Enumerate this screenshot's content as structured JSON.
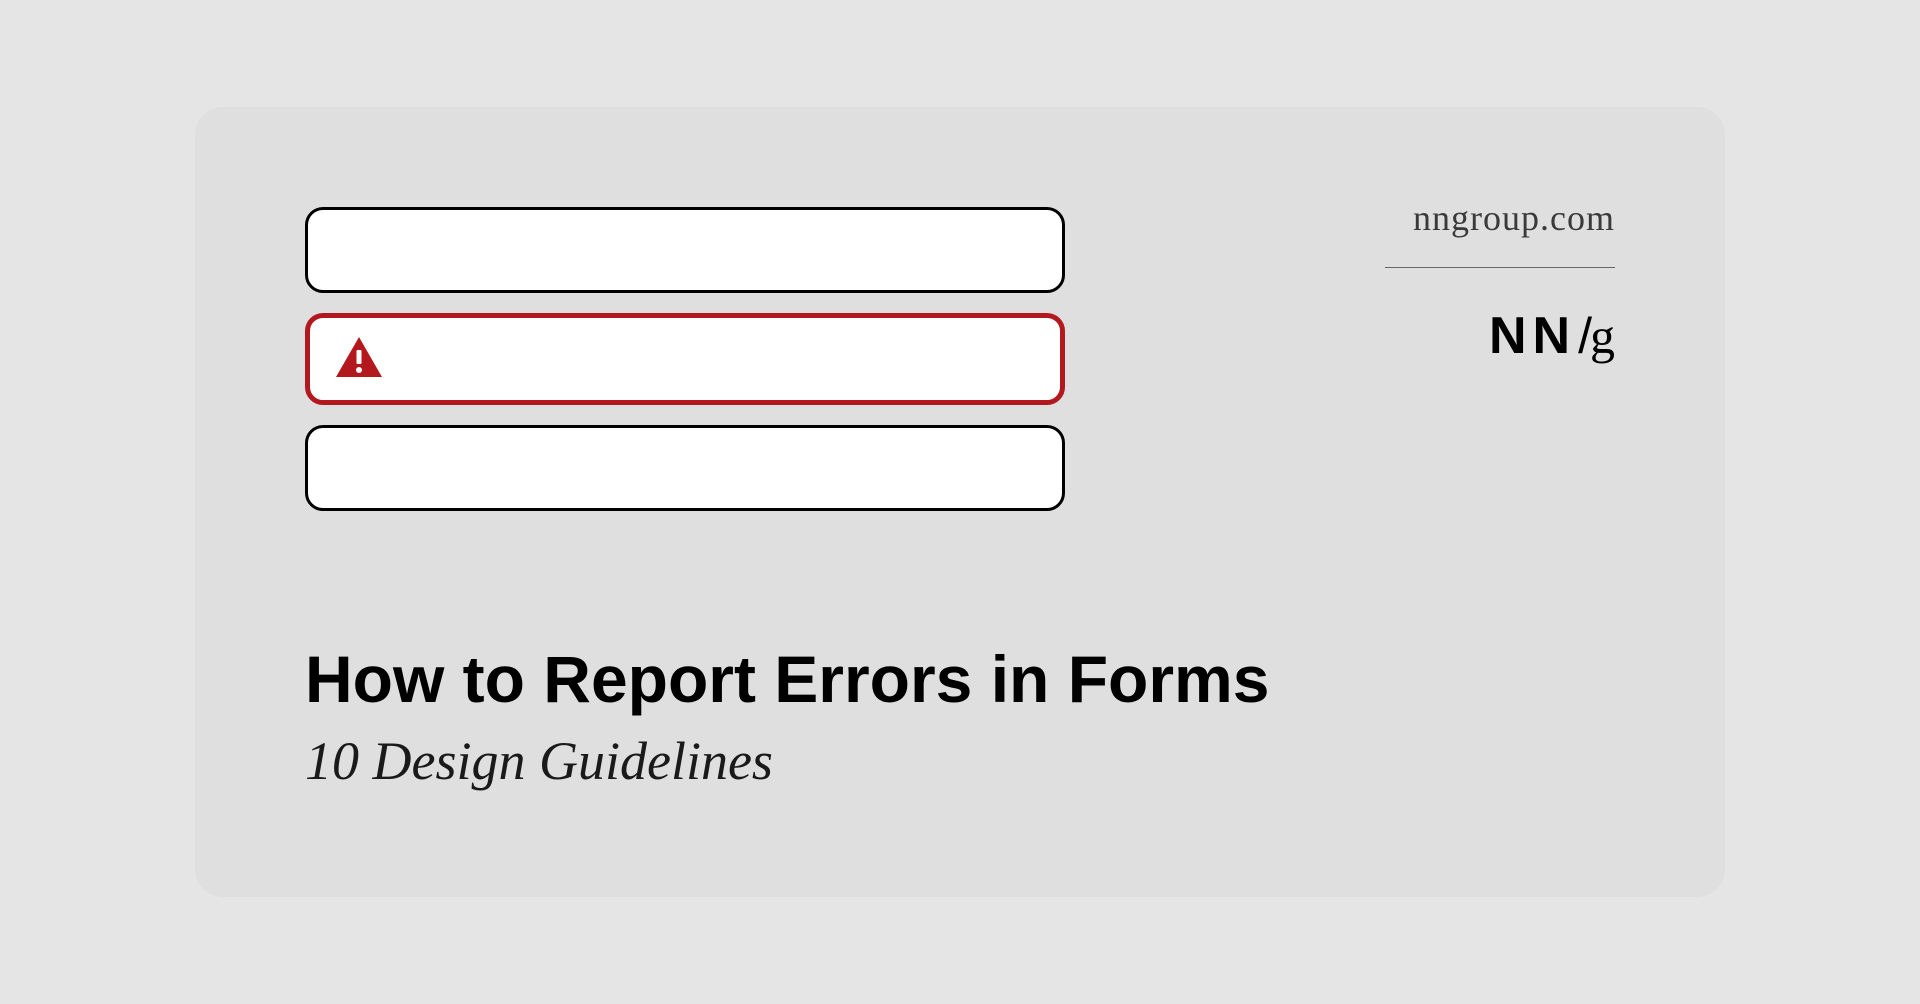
{
  "branding": {
    "url": "nngroup.com",
    "logo_nn": "NN",
    "logo_slash": "/",
    "logo_g": "g"
  },
  "content": {
    "title": "How to Report Errors in Forms",
    "subtitle": "10 Design Guidelines"
  },
  "colors": {
    "error": "#b3181f",
    "background": "#dfdfdf"
  }
}
